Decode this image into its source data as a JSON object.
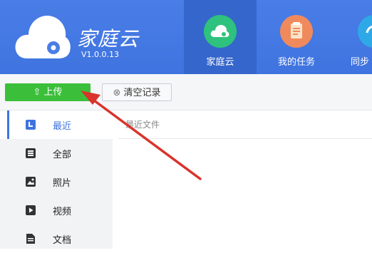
{
  "app": {
    "title": "家庭云",
    "version": "V1.0.0.13"
  },
  "tabs": [
    {
      "label": "家庭云",
      "icon": "cloud-icon",
      "active": true,
      "color": "#2ec27e"
    },
    {
      "label": "我的任务",
      "icon": "task-list-icon",
      "active": false,
      "color": "#f08a5d"
    },
    {
      "label": "同步",
      "icon": "sync-icon",
      "active": false,
      "color": "#2fa8e8"
    }
  ],
  "toolbar": {
    "upload_label": "上传",
    "clear_label": "清空记录"
  },
  "sidebar": {
    "items": [
      {
        "label": "最近",
        "icon": "recent-icon",
        "active": true
      },
      {
        "label": "全部",
        "icon": "list-icon",
        "active": false
      },
      {
        "label": "照片",
        "icon": "photo-icon",
        "active": false
      },
      {
        "label": "视频",
        "icon": "video-icon",
        "active": false
      },
      {
        "label": "文档",
        "icon": "document-icon",
        "active": false
      }
    ]
  },
  "content": {
    "header": "最近文件"
  },
  "colors": {
    "header_bg": "#4a7de6",
    "accent": "#3f74e0",
    "upload_green": "#3bbf3a",
    "annotation_arrow": "#d9342b"
  }
}
